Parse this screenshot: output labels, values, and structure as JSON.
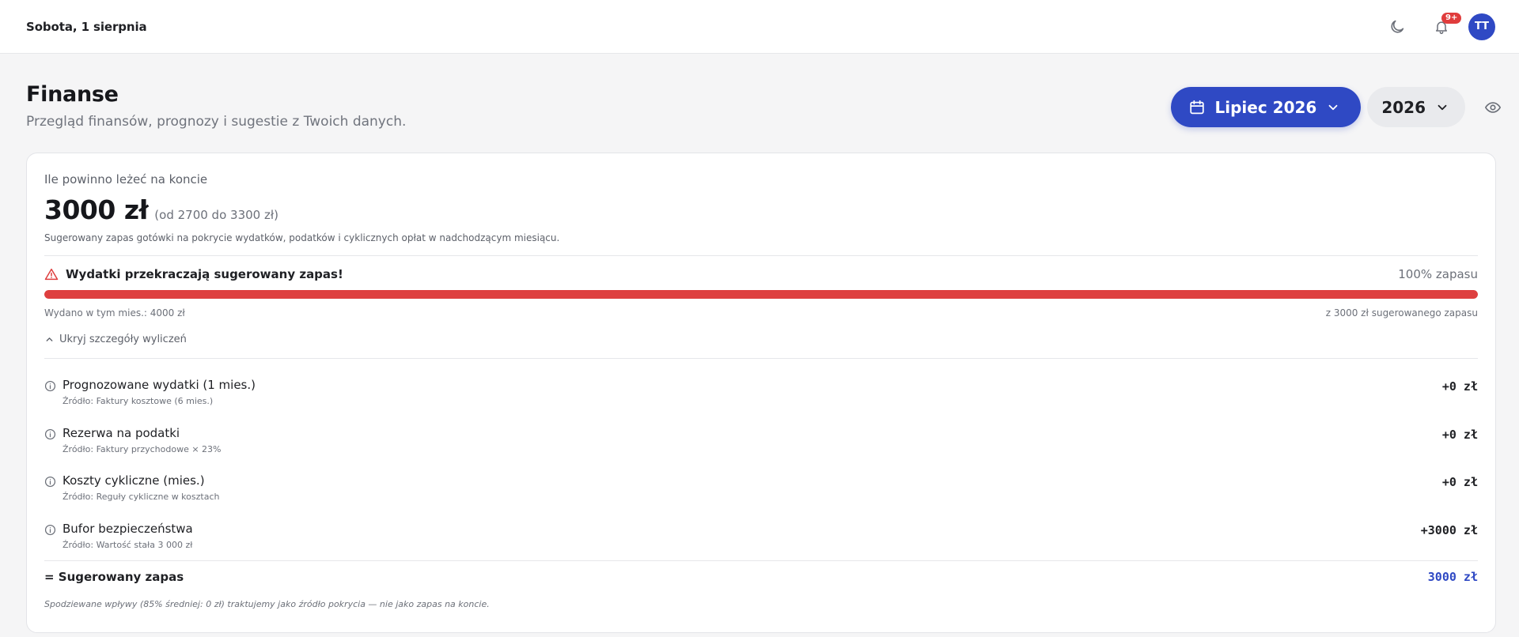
{
  "topbar": {
    "date": "Sobota, 1 sierpnia",
    "theme_icon": "moon-icon",
    "notifications_badge": "9+",
    "avatar_initials": "TT"
  },
  "header": {
    "title": "Finanse",
    "subtitle": "Przegląd finansów, prognozy i sugestie z Twoich danych.",
    "month_label": "Lipiec 2026",
    "year_label": "2026"
  },
  "card": {
    "label": "Ile powinno leżeć na koncie",
    "amount": "3000 zł",
    "range": "(od 2700 do 3300 zł)",
    "description": "Sugerowany zapas gotówki na pokrycie wydatków, podatków i cyklicznych opłat w nadchodzącym miesiącu.",
    "warning": "Wydatki przekraczają sugerowany zapas!",
    "percent_label": "100% zapasu",
    "progress_fraction": 1.0,
    "spent": "Wydano w tym mies.: 4000 zł",
    "of_reserve": "z 3000 zł sugerowanego zapasu",
    "toggle_label": "Ukryj szczegóły wyliczeń",
    "items": [
      {
        "title": "Prognozowane wydatki (1 mies.)",
        "source": "Źródło: Faktury kosztowe (6 mies.)",
        "value": "+0 zł"
      },
      {
        "title": "Rezerwa na podatki",
        "source": "Źródło: Faktury przychodowe × 23%",
        "value": "+0 zł"
      },
      {
        "title": "Koszty cykliczne (mies.)",
        "source": "Źródło: Reguły cykliczne w kosztach",
        "value": "+0 zł"
      },
      {
        "title": "Bufor bezpieczeństwa",
        "source": "Źródło: Wartość stała 3 000 zł",
        "value": "+3000 zł"
      }
    ],
    "sum_label": "= Sugerowany zapas",
    "sum_value": "3000 zł",
    "footnote": "Spodziewane wpływy (85% średniej: 0 zł) traktujemy jako źródło pokrycia — nie jako zapas na koncie."
  },
  "colors": {
    "accent": "#2f49c4",
    "danger": "#de3f3f",
    "badge": "#e03c3c"
  }
}
